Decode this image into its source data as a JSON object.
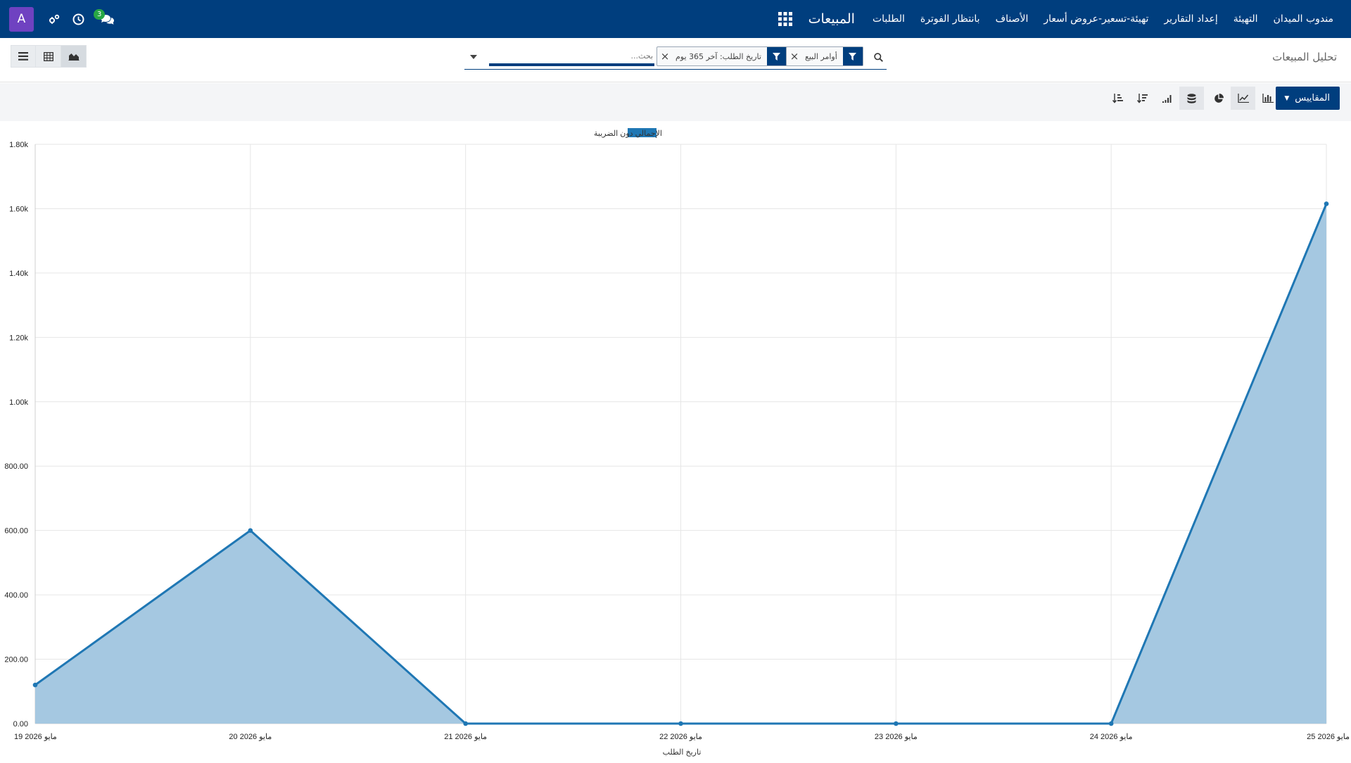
{
  "navbar": {
    "brand": "المبيعات",
    "menu": [
      "الطلبات",
      "بانتظار الفوترة",
      "الأصناف",
      "تهيئة-تسعير-عروض أسعار",
      "إعداد التقارير",
      "التهيئة",
      "مندوب الميدان"
    ],
    "avatar_letter": "A",
    "chat_count": "3",
    "icons": [
      "apps-icon",
      "settings-icon",
      "clock-icon",
      "chat-icon"
    ]
  },
  "control": {
    "breadcrumb": "تحليل المبيعات",
    "search_placeholder": "بحث...",
    "facets": [
      {
        "label": "أوامر البيع",
        "icon": "filter-icon"
      },
      {
        "label": "تاريخ الطلب: آخر 365 يوم",
        "icon": "filter-icon"
      }
    ],
    "views": [
      "list-view-icon",
      "pivot-view-icon",
      "graph-view-icon"
    ]
  },
  "graph_toolbar": {
    "measures_label": "المقاييس",
    "tools": [
      "bar-chart-icon",
      "line-chart-icon",
      "pie-chart-icon",
      "stacked-icon",
      "cumulative-icon",
      "sort-descending-icon",
      "sort-ascending-icon"
    ]
  },
  "colors": {
    "navbar": "#003e7e",
    "series_line": "#1f77b4",
    "series_fill": "#a5c8e1",
    "avatar": "#6f42c1",
    "badge": "#28a745"
  },
  "chart_data": {
    "type": "area",
    "x": [
      "19 مايو 2026",
      "20 مايو 2026",
      "21 مايو 2026",
      "22 مايو 2026",
      "23 مايو 2026",
      "24 مايو 2026",
      "25 مايو 2026"
    ],
    "series": [
      {
        "name": "الإجمالي دون الضريبة",
        "values": [
          120,
          600,
          0,
          0,
          0,
          0,
          1615
        ]
      }
    ],
    "xlabel": "تاريخ الطلب",
    "ylabel": "",
    "ylim": [
      0,
      1800
    ],
    "yticks": [
      "0.00",
      "200.00",
      "400.00",
      "600.00",
      "800.00",
      "1.00k",
      "1.20k",
      "1.40k",
      "1.60k",
      "1.80k"
    ],
    "grid": true,
    "legend": "top-center"
  }
}
